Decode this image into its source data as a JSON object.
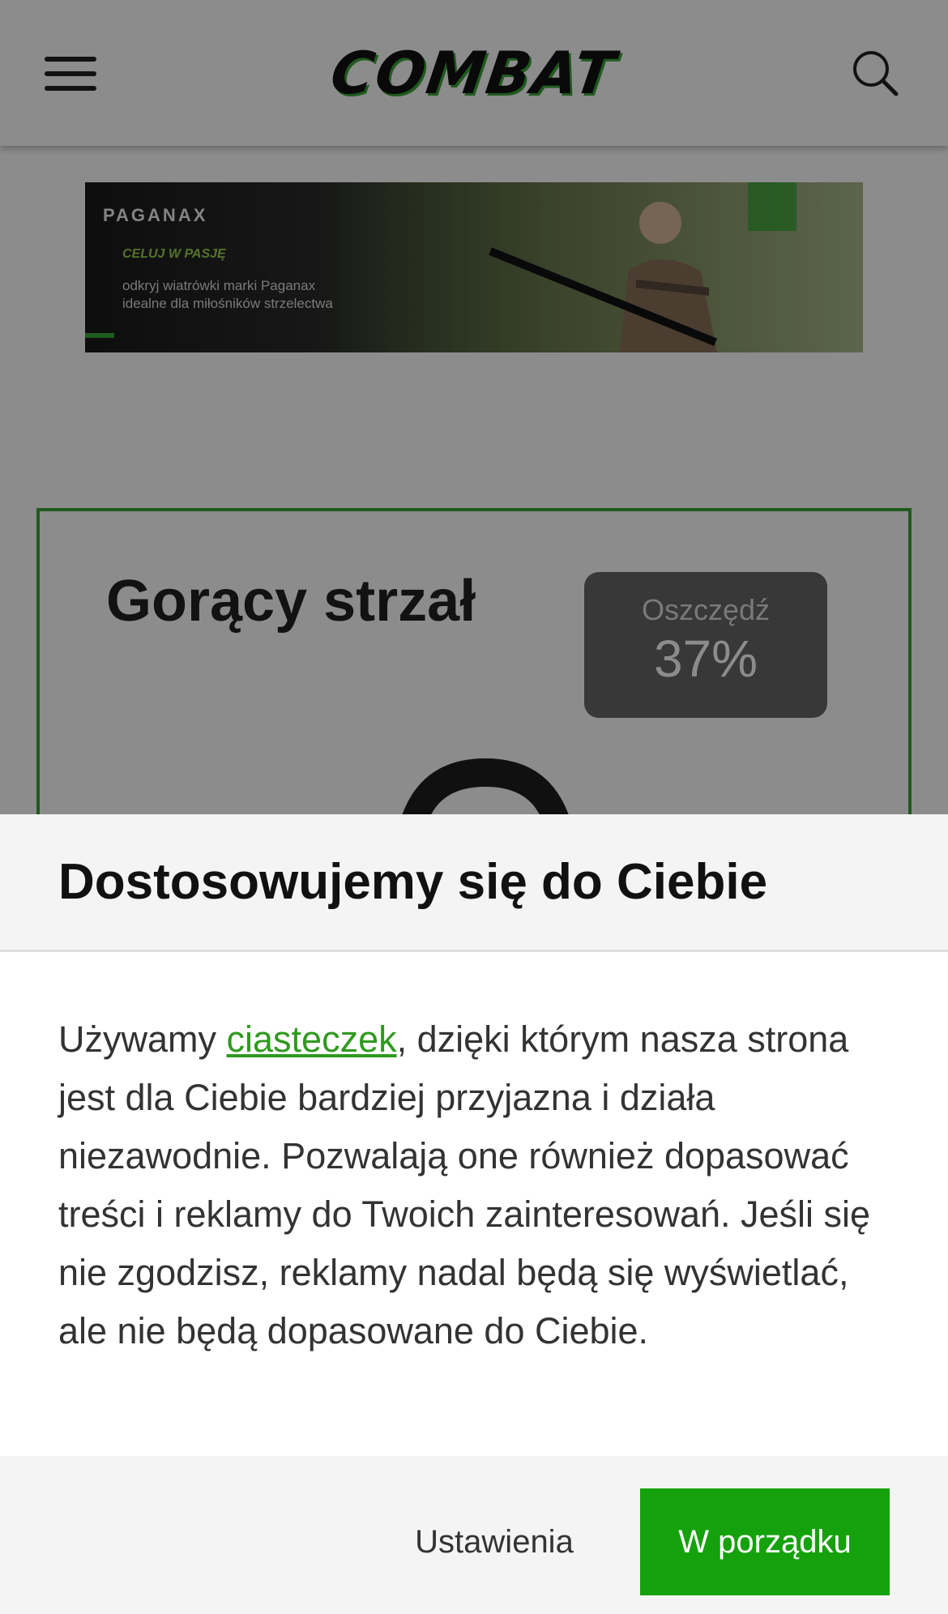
{
  "header": {
    "logo_text": "COMBAT",
    "menu_icon": "hamburger-menu-icon",
    "search_icon": "search-icon"
  },
  "banner": {
    "brand": "PAGANAX",
    "slogan": "CELUJ W PASJĘ",
    "line1": "odkryj wiatrówki marki Paganax",
    "line2": "idealne dla miłośników strzelectwa"
  },
  "hotshot": {
    "title": "Gorący strzał",
    "save_label": "Oszczędź",
    "save_percent": "37%"
  },
  "cookie": {
    "title": "Dostosowujemy się do Ciebie",
    "text_before_link": "Używamy ",
    "link_text": "ciasteczek",
    "text_after_link": ", dzięki którym nasza strona jest dla Ciebie bardziej przyjazna i działa niezawodnie. Pozwalają one również dopasować treści i reklamy do Twoich zainteresowań. Jeśli się nie zgodzisz, reklamy nadal będą się wyświetlać, ale nie będą dopasowane do Ciebie.",
    "settings_button": "Ustawienia",
    "ok_button": "W porządku"
  },
  "colors": {
    "accent_green": "#15a10c",
    "border_green": "#3aa537",
    "link_green": "#2f9a1f"
  }
}
